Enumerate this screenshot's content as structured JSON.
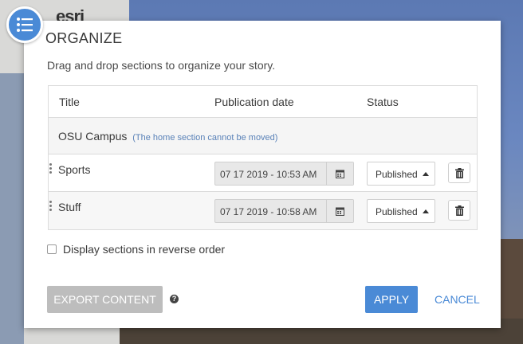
{
  "background": {
    "logo_text": "esri"
  },
  "modal": {
    "title": "ORGANIZE",
    "subtitle": "Drag and drop sections to organize your story.",
    "icon": "list-icon"
  },
  "table": {
    "headers": {
      "title": "Title",
      "date": "Publication date",
      "status": "Status"
    },
    "home": {
      "title": "OSU Campus",
      "note": "(The home section cannot be moved)"
    },
    "rows": [
      {
        "title": "Sports",
        "date": "07 17 2019 - 10:53 AM",
        "status": "Published"
      },
      {
        "title": "Stuff",
        "date": "07 17 2019 - 10:58 AM",
        "status": "Published"
      }
    ]
  },
  "options": {
    "reverse_label": "Display sections in reverse order"
  },
  "footer": {
    "export_label": "EXPORT CONTENT",
    "help": "?",
    "apply_label": "APPLY",
    "cancel_label": "CANCEL"
  },
  "colors": {
    "accent": "#4a8ad6",
    "disabled": "#bdbdbd"
  }
}
